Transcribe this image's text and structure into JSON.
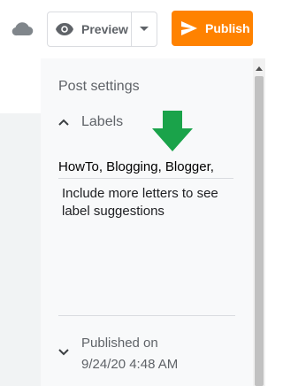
{
  "toolbar": {
    "preview_label": "Preview",
    "publish_label": "Publish"
  },
  "panel": {
    "title": "Post settings",
    "labels_section": {
      "title": "Labels",
      "input_value": "HowTo, Blogging, Blogger,",
      "suggestion_text": "Include more letters to see label suggestions"
    },
    "published": {
      "label": "Published on",
      "datetime": "9/24/20 4:48 AM"
    }
  },
  "colors": {
    "publish": "#ff8200",
    "annotation_arrow": "#1aa34a",
    "panel_bg": "#f8f9fa"
  }
}
